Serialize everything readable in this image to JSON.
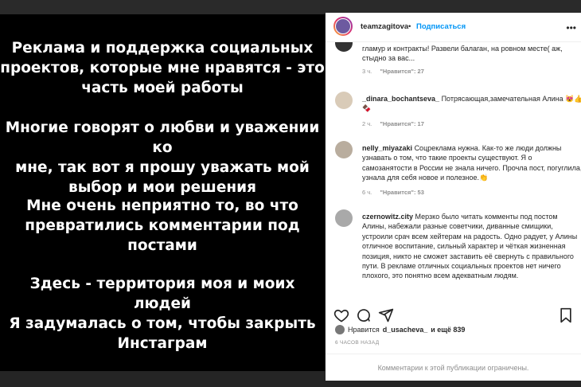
{
  "post": {
    "paragraphs": [
      "Реклама и поддержка социальных\nпроектов, которые мне нравятся - это\nчасть моей работы",
      "Многие говорят о любви и уважении ко\nмне, так вот я прошу уважать мой\nвыбор и мои решения",
      "Мне очень неприятно то, во что\nпревратились комментарии под\nпостами",
      "Здесь - территория моя и моих людей",
      "Я задумалась о том, чтобы закрыть\nИнстаграм"
    ]
  },
  "header": {
    "username": "teamzagitova",
    "separator": "•",
    "follow_label": "Подписаться"
  },
  "comments": [
    {
      "user": "",
      "text": "гламур и контракты! Развели балаган, на ровном месте( аж, стыдно за вас...",
      "time": "3 ч.",
      "likes": "\"Нравится\": 27"
    },
    {
      "user": "_dinara_bochantseva_",
      "text": "Потрясающая,замечательная Алина 😻👍🍫",
      "time": "2 ч.",
      "likes": "\"Нравится\": 17"
    },
    {
      "user": "nelly_miyazaki",
      "text": "Соцреклама нужна. Как-то же люди должны узнавать о том, что такие проекты существуют. Я о самозанятости в России не знала ничего. Прочла пост, погуглила, узнала для себя новое и полезное.👏",
      "time": "6 ч.",
      "likes": "\"Нравится\": 53"
    },
    {
      "user": "czernowitz.city",
      "text": "Мерзко было читать комменты под постом Алины, набежали разные советчики, диванные смищики, устроили срач всем хейтерам на радость. Одно радует, у Алины отличное воспитание, сильный характер и чёткая жизненная позиция, никто не сможет заставить её свернуть с правильного пути. В рекламе отличных социальных проектов нет ничего плохого, это понятно всем адекватным людям.",
      "time": "",
      "likes": ""
    }
  ],
  "likes_row": {
    "prefix": "Нравится",
    "user": "d_usacheva_",
    "suffix": "и ещё 839"
  },
  "timestamp": "6 ЧАСОВ НАЗАД",
  "comments_limited": "Комментарии к этой публикации ограничены.",
  "icons": [
    "heart-icon",
    "comment-icon",
    "share-icon",
    "bookmark-icon",
    "more-icon"
  ]
}
